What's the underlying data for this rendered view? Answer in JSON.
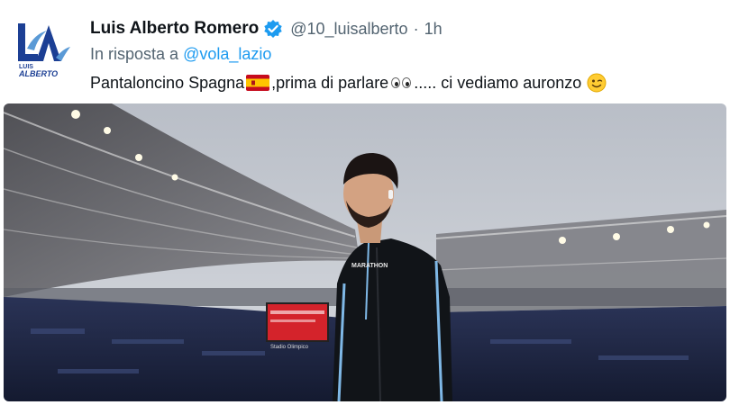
{
  "tweet": {
    "author_name": "Luis Alberto Romero",
    "handle": "@10_luisalberto",
    "separator": "·",
    "time": "1h",
    "reply_prefix": "In risposta a",
    "reply_to": "@vola_lazio",
    "text_part1": "Pantaloncino Spagna",
    "text_part2": ",prima di parlare",
    "text_part3": "..... ci vediamo auronzo",
    "emojis": [
      "spain-flag",
      "eyes",
      "winking-face"
    ],
    "verified": true
  },
  "avatar": {
    "logo_text": "LUIS ALBERTO",
    "logo_color": "#1c3f94"
  },
  "photo": {
    "scoreboard_text": "Stadio Olimpico",
    "jacket_brand": "MARATHON",
    "colors": {
      "sky": "#c9cdd4",
      "jacket": "#111418",
      "accent": "#7fb8e6",
      "crowd": "#1d2540",
      "scoreboard": "#d4232b"
    }
  }
}
